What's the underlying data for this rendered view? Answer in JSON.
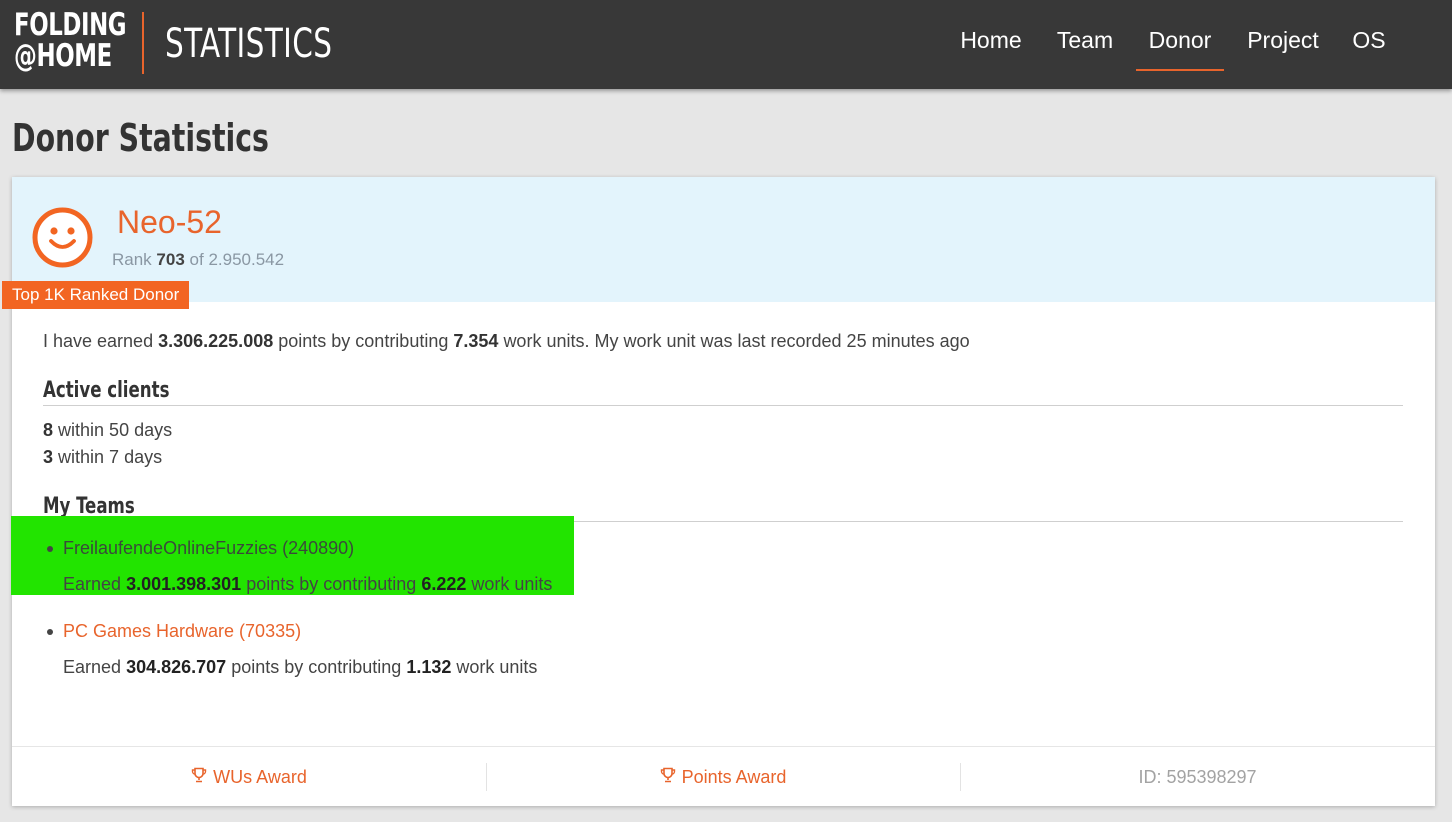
{
  "header": {
    "logo_line1": "FOLDING",
    "logo_line2": "@HOME",
    "site_title": "STATISTICS",
    "nav": [
      {
        "label": "Home"
      },
      {
        "label": "Team"
      },
      {
        "label": "Donor",
        "active": true
      },
      {
        "label": "Project"
      },
      {
        "label": "OS"
      }
    ]
  },
  "page": {
    "title": "Donor Statistics"
  },
  "donor": {
    "name": "Neo-52",
    "rank_label": "Rank",
    "rank": "703",
    "rank_of": "of",
    "rank_total": "2.950.542",
    "badge": "Top 1K Ranked Donor",
    "avatar_icon": "smiley-face-icon",
    "summary": {
      "prefix": "I have earned",
      "points": "3.306.225.008",
      "mid": "points by contributing",
      "work_units": "7.354",
      "suffix": "work units. My work unit was last recorded 25 minutes ago"
    }
  },
  "active_clients": {
    "heading": "Active clients",
    "rows": [
      {
        "count": "8",
        "text": "within 50 days"
      },
      {
        "count": "3",
        "text": "within 7 days"
      }
    ]
  },
  "teams": {
    "heading": "My Teams",
    "earned_label": "Earned",
    "points_label": "points by contributing",
    "wu_label": "work units",
    "items": [
      {
        "name": "FreilaufendeOnlineFuzzies (240890)",
        "points": "3.001.398.301",
        "work_units": "6.222",
        "highlighted": true
      },
      {
        "name": "PC Games Hardware (70335)",
        "points": "304.826.707",
        "work_units": "1.132",
        "highlighted": false
      }
    ]
  },
  "footer": {
    "wus_award": "WUs Award",
    "points_award": "Points Award",
    "id_text": "ID: 595398297",
    "award_icon": "trophy-icon"
  },
  "colors": {
    "accent": "#e8642c",
    "header_bg": "#383838",
    "card_header_bg": "#e3f4fc",
    "badge_bg": "#f26522",
    "highlight": "#22e400"
  }
}
